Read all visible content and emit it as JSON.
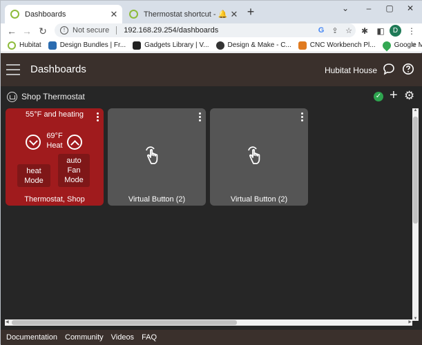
{
  "browser": {
    "tabs": [
      {
        "title": "Dashboards",
        "active": true
      },
      {
        "title": "Thermostat shortcut - 🔔 Get He",
        "active": false
      }
    ],
    "new_tab": "+",
    "window_controls": {
      "minimize": "–",
      "maximize": "▢",
      "close": "✕"
    },
    "address": {
      "security": "Not secure",
      "url": "192.168.29.254/dashboards"
    },
    "profile_initial": "D",
    "bookmarks": [
      {
        "label": "Hubitat",
        "color": "#8dbb3a"
      },
      {
        "label": "Design Bundles | Fr...",
        "color": "#2b6cb0"
      },
      {
        "label": "Gadgets Library | V...",
        "color": "#222222"
      },
      {
        "label": "Design & Make - C...",
        "color": "#333333"
      },
      {
        "label": "CNC Workbench Pl...",
        "color": "#e07a1f"
      },
      {
        "label": "Google Maps",
        "color": "#34a853"
      }
    ],
    "bookmarks_more": "»"
  },
  "app": {
    "title": "Dashboards",
    "hub_name": "Hubitat House"
  },
  "dashboard": {
    "name": "Shop Thermostat",
    "tiles": [
      {
        "type": "thermostat",
        "status": "55°F and heating",
        "setpoint": "69°F",
        "setpoint_mode": "Heat",
        "mode_value": "heat",
        "mode_label": "Mode",
        "fan_value": "auto",
        "fan_label1": "Fan",
        "fan_label2": "Mode",
        "label": "Thermostat, Shop",
        "color": "#a01b1d"
      },
      {
        "type": "button",
        "label": "Virtual Button (2)",
        "icon": "hand-tap-icon",
        "color": "#555555"
      },
      {
        "type": "button",
        "label": "Virtual Button (2)",
        "icon": "hand-tap-icon",
        "color": "#555555"
      }
    ]
  },
  "footer": {
    "links": [
      "Documentation",
      "Community",
      "Videos",
      "FAQ"
    ]
  }
}
